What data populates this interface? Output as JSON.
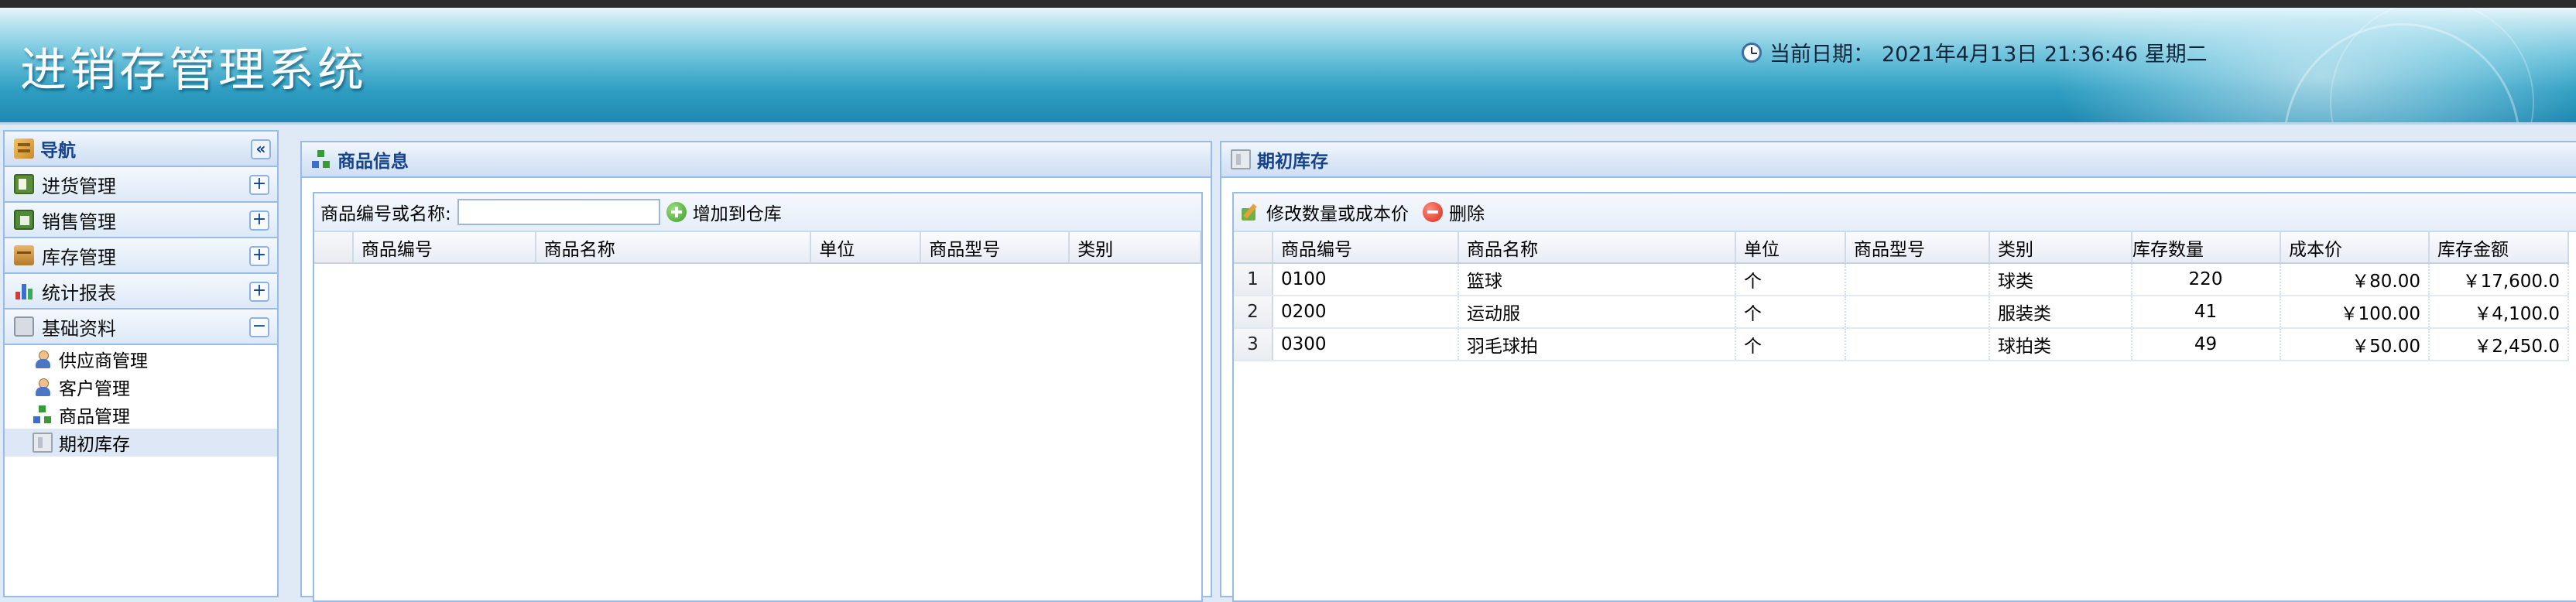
{
  "header": {
    "app_title": "进销存管理系统",
    "date_label": "当前日期：",
    "date_value": "2021年4月13日 21:36:46 星期二"
  },
  "nav": {
    "title": "导航",
    "collapse_symbol": "«",
    "sections": [
      {
        "label": "进货管理",
        "icon": "purchase-icon",
        "toggle": "+"
      },
      {
        "label": "销售管理",
        "icon": "sales-icon",
        "toggle": "+"
      },
      {
        "label": "库存管理",
        "icon": "stock-icon",
        "toggle": "+"
      },
      {
        "label": "统计报表",
        "icon": "chart-icon",
        "toggle": "+"
      },
      {
        "label": "基础资料",
        "icon": "basic-data-icon",
        "toggle": "−"
      }
    ],
    "sub_items": [
      {
        "label": "供应商管理",
        "icon": "user-icon"
      },
      {
        "label": "客户管理",
        "icon": "user-icon"
      },
      {
        "label": "商品管理",
        "icon": "goods-icon"
      },
      {
        "label": "期初库存",
        "icon": "store-icon",
        "selected": true
      }
    ]
  },
  "goods_panel": {
    "title": "商品信息",
    "search_label": "商品编号或名称:",
    "search_value": "",
    "add_button": "增加到仓库",
    "columns": [
      "商品编号",
      "商品名称",
      "单位",
      "商品型号",
      "类别"
    ],
    "rows": []
  },
  "stock_panel": {
    "title": "期初库存",
    "edit_button": "修改数量或成本价",
    "delete_button": "删除",
    "columns": [
      "商品编号",
      "商品名称",
      "单位",
      "商品型号",
      "类别",
      "库存数量",
      "成本价",
      "库存金额"
    ],
    "rows": [
      {
        "no": "1",
        "code": "0100",
        "name": "篮球",
        "unit": "个",
        "model": "",
        "category": "球类",
        "qty": "220",
        "cost": "￥80.00",
        "amount": "￥17,600.0"
      },
      {
        "no": "2",
        "code": "0200",
        "name": "运动服",
        "unit": "个",
        "model": "",
        "category": "服装类",
        "qty": "41",
        "cost": "￥100.00",
        "amount": "￥4,100.0"
      },
      {
        "no": "3",
        "code": "0300",
        "name": "羽毛球拍",
        "unit": "个",
        "model": "",
        "category": "球拍类",
        "qty": "49",
        "cost": "￥50.00",
        "amount": "￥2,450.0"
      }
    ]
  }
}
